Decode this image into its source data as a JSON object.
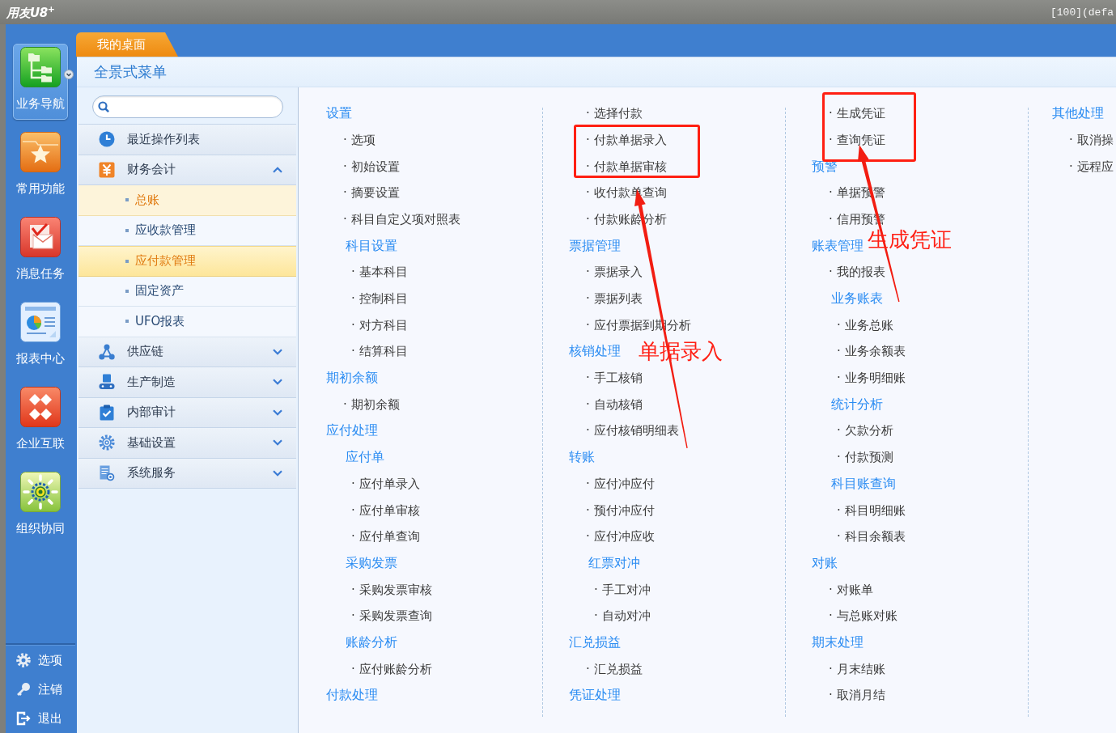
{
  "title_bar": {
    "logo": "用友U8$^{+}$",
    "status": "[100](defa"
  },
  "nav_rail": {
    "items": [
      {
        "label": "业务导航",
        "selected": true
      },
      {
        "label": "常用功能",
        "selected": false
      },
      {
        "label": "消息任务",
        "selected": false
      },
      {
        "label": "报表中心",
        "selected": false
      },
      {
        "label": "企业互联",
        "selected": false
      },
      {
        "label": "组织协同",
        "selected": false
      }
    ],
    "footer": [
      {
        "label": "选项"
      },
      {
        "label": "注销"
      },
      {
        "label": "退出"
      }
    ]
  },
  "tabs": [
    {
      "label": "我的桌面",
      "selected": true
    }
  ],
  "panel": {
    "title": "全景式菜单"
  },
  "tree": [
    {
      "kind": "link",
      "label": "最近操作列表"
    },
    {
      "kind": "group",
      "label": "财务会计",
      "expanded": true,
      "children": [
        {
          "label": "总账",
          "selected": false,
          "hovered": true
        },
        {
          "label": "应收款管理",
          "selected": false,
          "hovered": false
        },
        {
          "label": "应付款管理",
          "selected": true,
          "hovered": false
        },
        {
          "label": "固定资产",
          "selected": false,
          "hovered": false
        },
        {
          "label": "UFO报表",
          "selected": false,
          "hovered": false
        }
      ]
    },
    {
      "kind": "group",
      "label": "供应链",
      "expanded": false
    },
    {
      "kind": "group",
      "label": "生产制造",
      "expanded": false
    },
    {
      "kind": "group",
      "label": "内部审计",
      "expanded": false
    },
    {
      "kind": "group",
      "label": "基础设置",
      "expanded": false
    },
    {
      "kind": "group",
      "label": "系统服务",
      "expanded": false
    }
  ],
  "menu": {
    "columns": [
      [
        {
          "kind": "heading",
          "label": "设置",
          "children": [
            {
              "kind": "item",
              "label": "· 选项"
            },
            {
              "kind": "item",
              "label": "· 初始设置"
            },
            {
              "kind": "item",
              "label": "· 摘要设置"
            },
            {
              "kind": "item",
              "label": "· 科目自定义项对照表"
            },
            {
              "kind": "heading",
              "label": "科目设置",
              "children": [
                {
                  "kind": "item",
                  "label": "· 基本科目"
                },
                {
                  "kind": "item",
                  "label": "· 控制科目"
                },
                {
                  "kind": "item",
                  "label": "· 对方科目"
                },
                {
                  "kind": "item",
                  "label": "· 结算科目"
                }
              ]
            }
          ]
        },
        {
          "kind": "heading",
          "label": "期初余额",
          "children": [
            {
              "kind": "item",
              "label": "· 期初余额"
            }
          ]
        },
        {
          "kind": "heading",
          "label": "应付处理",
          "children": [
            {
              "kind": "heading",
              "label": "应付单",
              "children": [
                {
                  "kind": "item",
                  "label": "· 应付单录入"
                },
                {
                  "kind": "item",
                  "label": "· 应付单审核"
                },
                {
                  "kind": "item",
                  "label": "· 应付单查询"
                }
              ]
            },
            {
              "kind": "heading",
              "label": "采购发票",
              "children": [
                {
                  "kind": "item",
                  "label": "· 采购发票审核"
                },
                {
                  "kind": "item",
                  "label": "· 采购发票查询"
                }
              ]
            },
            {
              "kind": "heading",
              "label": "账龄分析",
              "children": [
                {
                  "kind": "item",
                  "label": "· 应付账龄分析"
                }
              ]
            }
          ]
        },
        {
          "kind": "heading",
          "label": "付款处理"
        }
      ],
      [
        {
          "kind": "continued",
          "children": [
            {
              "kind": "item",
              "label": "· 选择付款"
            },
            {
              "kind": "callout",
              "label": "单据录入",
              "children": [
                {
                  "kind": "item",
                  "label": "· 付款单据录入"
                },
                {
                  "kind": "item",
                  "label": "· 付款单据审核"
                }
              ]
            },
            {
              "kind": "item",
              "label": "· 收付款单查询"
            },
            {
              "kind": "item",
              "label": "· 付款账龄分析"
            }
          ]
        },
        {
          "kind": "heading",
          "label": "票据管理",
          "children": [
            {
              "kind": "item",
              "label": "· 票据录入"
            },
            {
              "kind": "item",
              "label": "· 票据列表"
            },
            {
              "kind": "item",
              "label": "· 应付票据到期分析"
            }
          ]
        },
        {
          "kind": "heading",
          "label": "核销处理",
          "children": [
            {
              "kind": "item",
              "label": "· 手工核销"
            },
            {
              "kind": "item",
              "label": "· 自动核销"
            },
            {
              "kind": "item",
              "label": "· 应付核销明细表"
            }
          ]
        },
        {
          "kind": "heading",
          "label": "转账",
          "children": [
            {
              "kind": "item",
              "label": "· 应付冲应付"
            },
            {
              "kind": "item",
              "label": "· 预付冲应付"
            },
            {
              "kind": "item",
              "label": "· 应付冲应收"
            },
            {
              "kind": "heading",
              "label": "红票对冲",
              "children": [
                {
                  "kind": "item",
                  "label": "· 手工对冲"
                },
                {
                  "kind": "item",
                  "label": "· 自动对冲"
                }
              ]
            }
          ]
        },
        {
          "kind": "heading",
          "label": "汇兑损益",
          "children": [
            {
              "kind": "item",
              "label": "· 汇兑损益"
            }
          ]
        },
        {
          "kind": "heading",
          "label": "凭证处理"
        }
      ],
      [
        {
          "kind": "continued",
          "children": [
            {
              "kind": "callout",
              "label": "生成凭证",
              "children": [
                {
                  "kind": "item",
                  "label": "· 生成凭证"
                },
                {
                  "kind": "item",
                  "label": "· 查询凭证"
                }
              ]
            }
          ]
        },
        {
          "kind": "heading",
          "label": "预警",
          "children": [
            {
              "kind": "item",
              "label": "· 单据预警"
            },
            {
              "kind": "item",
              "label": "· 信用预警"
            }
          ]
        },
        {
          "kind": "heading",
          "label": "账表管理",
          "children": [
            {
              "kind": "item",
              "label": "· 我的报表"
            },
            {
              "kind": "heading",
              "label": "业务账表",
              "children": [
                {
                  "kind": "item",
                  "label": "· 业务总账"
                },
                {
                  "kind": "item",
                  "label": "· 业务余额表"
                },
                {
                  "kind": "item",
                  "label": "· 业务明细账"
                }
              ]
            },
            {
              "kind": "heading",
              "label": "统计分析",
              "children": [
                {
                  "kind": "item",
                  "label": "· 欠款分析"
                },
                {
                  "kind": "item",
                  "label": "· 付款预测"
                }
              ]
            },
            {
              "kind": "heading",
              "label": "科目账查询",
              "children": [
                {
                  "kind": "item",
                  "label": "· 科目明细账"
                },
                {
                  "kind": "item",
                  "label": "· 科目余额表"
                }
              ]
            }
          ]
        },
        {
          "kind": "heading",
          "label": "对账",
          "children": [
            {
              "kind": "item",
              "label": "· 对账单"
            },
            {
              "kind": "item",
              "label": "· 与总账对账"
            }
          ]
        },
        {
          "kind": "heading",
          "label": "期末处理",
          "children": [
            {
              "kind": "item",
              "label": "· 月末结账"
            },
            {
              "kind": "item",
              "label": "· 取消月结"
            }
          ]
        }
      ],
      [
        {
          "kind": "heading",
          "label": "其他处理",
          "children": [
            {
              "kind": "item",
              "label": "· 取消操"
            },
            {
              "kind": "item",
              "label": "· 远程应"
            }
          ]
        }
      ]
    ]
  }
}
